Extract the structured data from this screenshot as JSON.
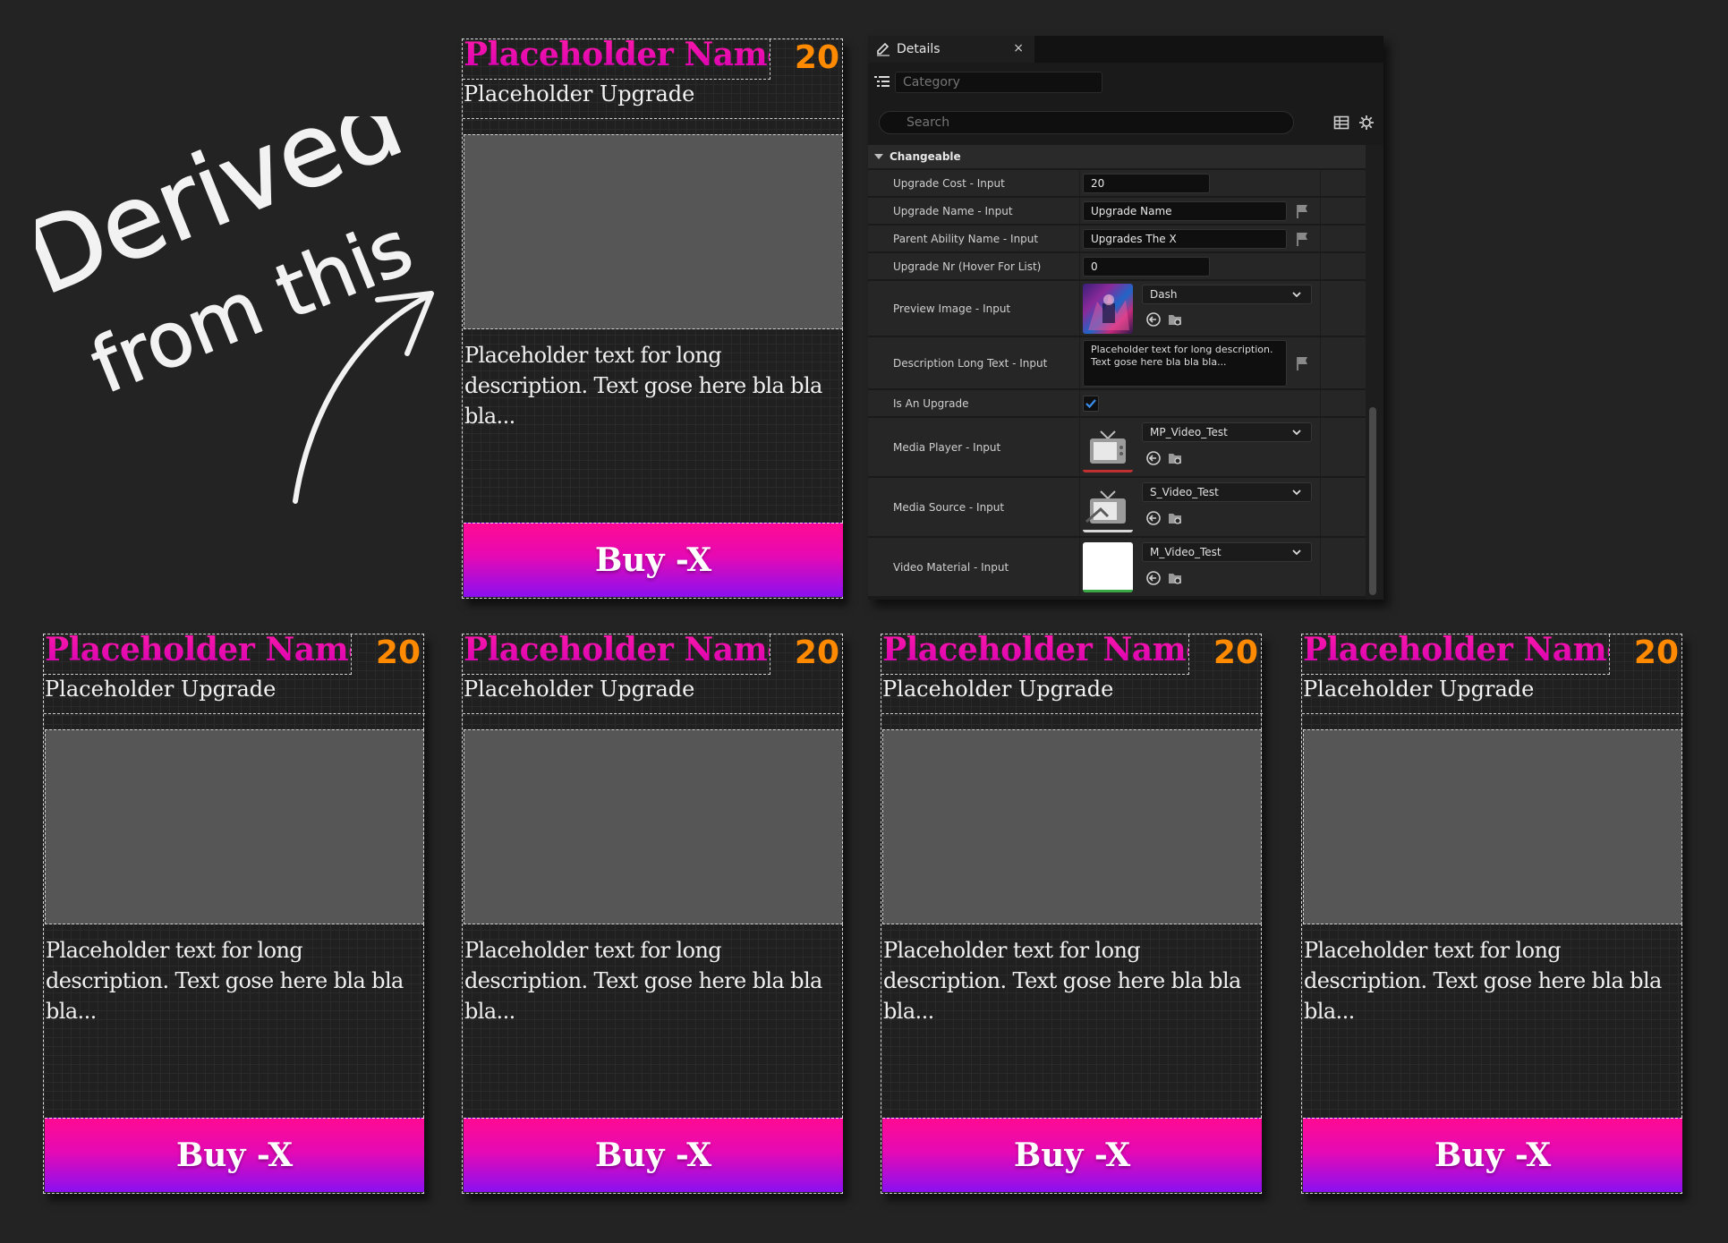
{
  "annotation": {
    "line1": "Derived",
    "line2": "from this"
  },
  "card": {
    "name": "Placeholder Name",
    "cost": "20",
    "subtitle": "Placeholder Upgrade",
    "description": "Placeholder text for long description. Text gose here bla bla bla...",
    "buy_label": "Buy -X"
  },
  "colors": {
    "name_gradient": [
      "#ff1aa8",
      "#d500b4"
    ],
    "cost": "#ff8a00",
    "buy_gradient": [
      "#ff0a92",
      "#e609b4",
      "#8a10f0"
    ],
    "preview": "#565656",
    "background": "#232323"
  },
  "details": {
    "tab_label": "Details",
    "close_glyph": "×",
    "category_placeholder": "Category",
    "search_placeholder": "Search",
    "section_label": "Changeable",
    "rows": {
      "upgrade_cost": {
        "label": "Upgrade Cost - Input",
        "value": "20"
      },
      "upgrade_name": {
        "label": "Upgrade Name - Input",
        "value": "Upgrade Name"
      },
      "parent_ability": {
        "label": "Parent Ability Name - Input",
        "value": "Upgrades The X"
      },
      "upgrade_nr": {
        "label": "Upgrade Nr (Hover For List)",
        "value": "0"
      },
      "preview_image": {
        "label": "Preview Image - Input",
        "value": "Dash"
      },
      "description": {
        "label": "Description Long Text - Input",
        "value": "Placeholder text for long description. Text gose here bla bla bla..."
      },
      "is_upgrade": {
        "label": "Is An Upgrade",
        "checked": true
      },
      "media_player": {
        "label": "Media Player - Input",
        "value": "MP_Video_Test"
      },
      "media_source": {
        "label": "Media Source - Input",
        "value": "S_Video_Test"
      },
      "video_material": {
        "label": "Video Material - Input",
        "value": "M_Video_Test"
      }
    }
  }
}
